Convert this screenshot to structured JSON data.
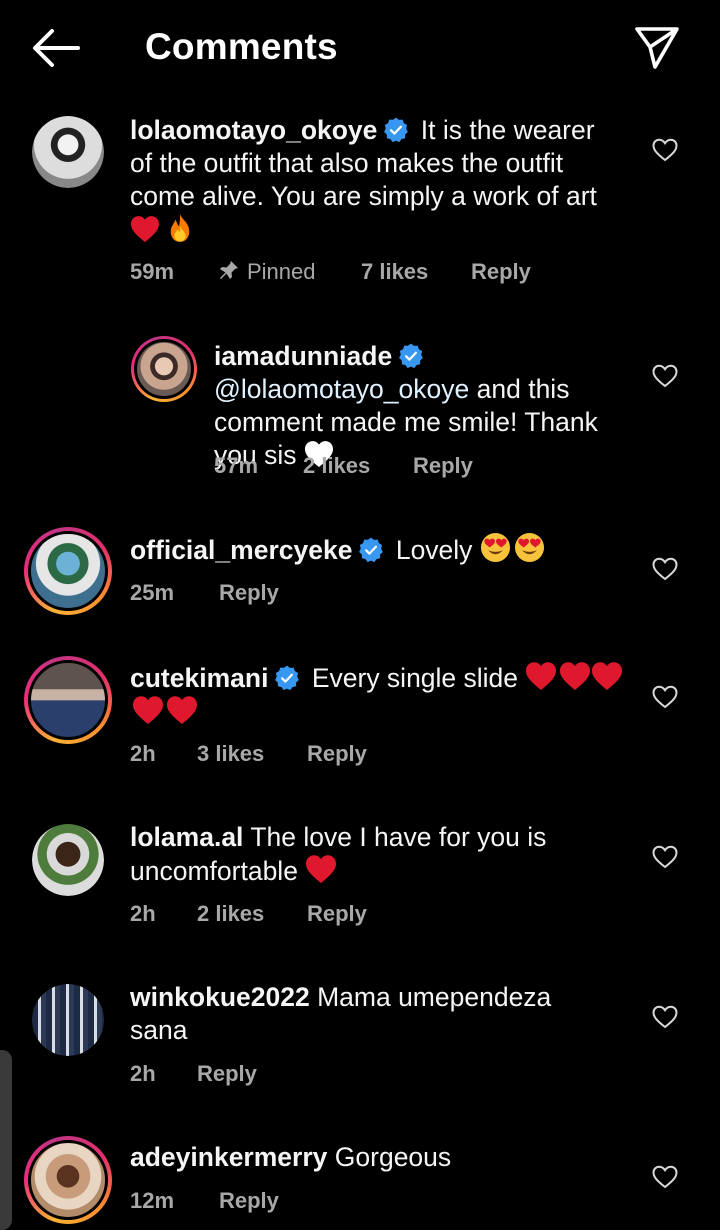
{
  "header": {
    "title": "Comments"
  },
  "comments": [
    {
      "username": "lolaomotayo_okoye",
      "verified": true,
      "text": "It is the wearer of the outfit that also makes the outfit come alive. You are simply a work of art",
      "time": "59m",
      "pinned_label": "Pinned",
      "likes": "7 likes",
      "reply": "Reply"
    },
    {
      "username": "iamadunniade",
      "verified": true,
      "mention": "@lolaomotayo_okoye",
      "text": "and this comment made me smile! Thank you sis",
      "time": "57m",
      "likes": "2 likes",
      "reply": "Reply"
    },
    {
      "username": "official_mercyeke",
      "verified": true,
      "text": "Lovely",
      "time": "25m",
      "reply": "Reply"
    },
    {
      "username": "cutekimani",
      "verified": true,
      "text": "Every single slide",
      "time": "2h",
      "likes": "3 likes",
      "reply": "Reply"
    },
    {
      "username": "lolama.al",
      "verified": false,
      "text": "The love I have for you is uncomfortable",
      "time": "2h",
      "likes": "2 likes",
      "reply": "Reply"
    },
    {
      "username": "winkokue2022",
      "verified": false,
      "text": "Mama umependeza sana",
      "time": "2h",
      "reply": "Reply"
    },
    {
      "username": "adeyinkermerry",
      "verified": false,
      "text": "Gorgeous",
      "time": "12m",
      "reply": "Reply"
    }
  ],
  "icons": {
    "back": "arrow-left-icon",
    "send": "paper-plane-icon",
    "verified": "verified-badge-icon",
    "like": "heart-outline-icon",
    "pin": "pin-icon"
  },
  "colors": {
    "background": "#000000",
    "text": "#ffffff",
    "meta": "#a8a8a8",
    "verified": "#3897f0"
  }
}
